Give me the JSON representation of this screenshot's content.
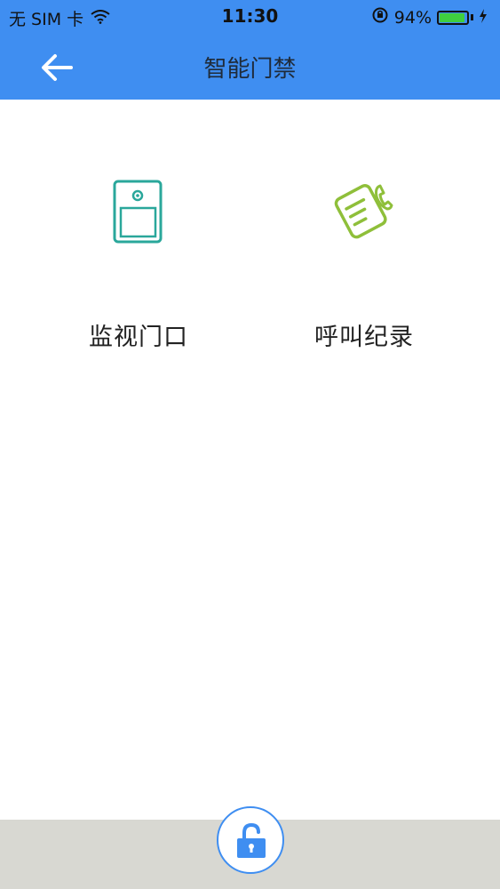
{
  "status_bar": {
    "carrier": "无 SIM 卡",
    "time": "11:30",
    "battery_percent": "94%",
    "battery_level": 0.94,
    "icons": [
      "wifi-icon",
      "orientation-lock-icon",
      "battery-icon",
      "charging-bolt-icon"
    ]
  },
  "nav": {
    "title": "智能门禁",
    "back_icon": "back-arrow-icon"
  },
  "tiles": [
    {
      "label": "监视门口",
      "icon": "door-monitor-icon",
      "color": "#2aa79b"
    },
    {
      "label": "呼叫纪录",
      "icon": "call-record-icon",
      "color": "#8fbf3a"
    }
  ],
  "bottom": {
    "unlock_icon": "unlock-icon",
    "accent": "#3f8ef1"
  },
  "colors": {
    "header": "#3f8ef1",
    "bottom_bar": "#d8d8d2"
  }
}
